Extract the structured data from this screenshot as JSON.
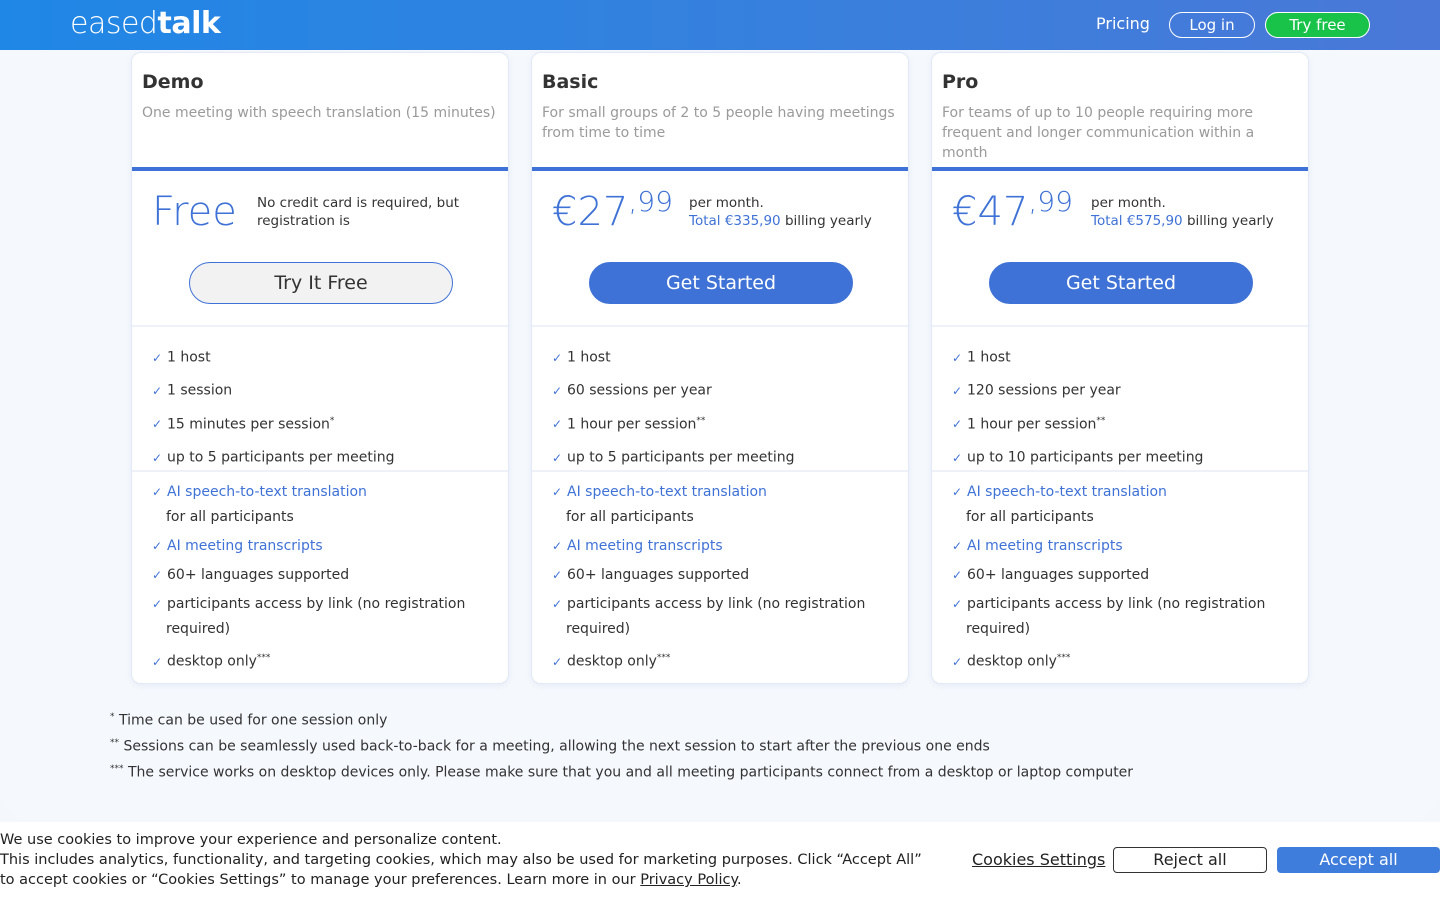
{
  "header": {
    "logo_light": "eased",
    "logo_bold": "talk",
    "nav_pricing": "Pricing",
    "nav_login": "Log in",
    "nav_try": "Try free"
  },
  "plans": [
    {
      "name": "Demo",
      "description": "One meeting with speech translation (15 minutes)",
      "price_main": "Free",
      "price_cents": "",
      "note": "No credit card is required, but registration is",
      "button": "Try It Free",
      "features": [
        {
          "text": "1 host",
          "sup": ""
        },
        {
          "text": "1 session",
          "sup": ""
        },
        {
          "text": "15 minutes per session",
          "sup": "*"
        },
        {
          "text": "up to 5 participants per meeting",
          "sup": ""
        }
      ]
    },
    {
      "name": "Basic",
      "description": "For small groups of 2 to 5 people having meetings from time to time",
      "price_main": "€27",
      "price_cents": ",99",
      "per_month": "per month.",
      "total": "Total €335,90",
      "billing": " billing yearly",
      "button": "Get Started",
      "features": [
        {
          "text": "1 host",
          "sup": ""
        },
        {
          "text": "60 sessions per year",
          "sup": ""
        },
        {
          "text": "1 hour per session",
          "sup": "**"
        },
        {
          "text": "up to 5 participants per meeting",
          "sup": ""
        }
      ]
    },
    {
      "name": "Pro",
      "description": "For teams of up to 10 people requiring more frequent and longer communication within a month",
      "price_main": "€47",
      "price_cents": ",99",
      "per_month": "per month.",
      "total": "Total €575,90",
      "billing": " billing yearly",
      "button": "Get Started",
      "features": [
        {
          "text": "1 host",
          "sup": ""
        },
        {
          "text": "120 sessions per year",
          "sup": ""
        },
        {
          "text": "1 hour per session",
          "sup": "**"
        },
        {
          "text": "up to 10 participants per meeting",
          "sup": ""
        }
      ]
    }
  ],
  "common_features": {
    "translation": "AI speech-to-text translation",
    "translation_cont": "for all participants",
    "transcripts": "AI meeting transcripts",
    "languages": "60+ languages supported",
    "access": "participants access by link (no registration",
    "access_cont": "required)",
    "desktop": "desktop only",
    "desktop_sup": "***"
  },
  "footnotes": {
    "f1_mark": "*",
    "f1": " Time can be used for one session only",
    "f2_mark": "**",
    "f2": " Sessions can be seamlessly used back-to-back for a meeting, allowing the next session to start after the previous one ends",
    "f3_mark": "***",
    "f3": " The service works on desktop devices only. Please make sure that you and all meeting participants connect from a desktop or laptop computer"
  },
  "cookie": {
    "line1": "We use cookies to improve your experience and personalize content.",
    "line2": "This includes analytics, functionality, and targeting cookies, which may also be used for marketing purposes. Click “Accept All” to accept cookies or “Cookies Settings” to manage your preferences. Learn more in our ",
    "privacy_link": "Privacy Policy",
    "period": ".",
    "settings": "Cookies Settings",
    "reject": "Reject all",
    "accept": "Accept all"
  },
  "colors": {
    "accent": "#3f72d6",
    "header_start": "#1f87e6",
    "try_free_green": "#19c34a"
  },
  "check_icon": "✓"
}
